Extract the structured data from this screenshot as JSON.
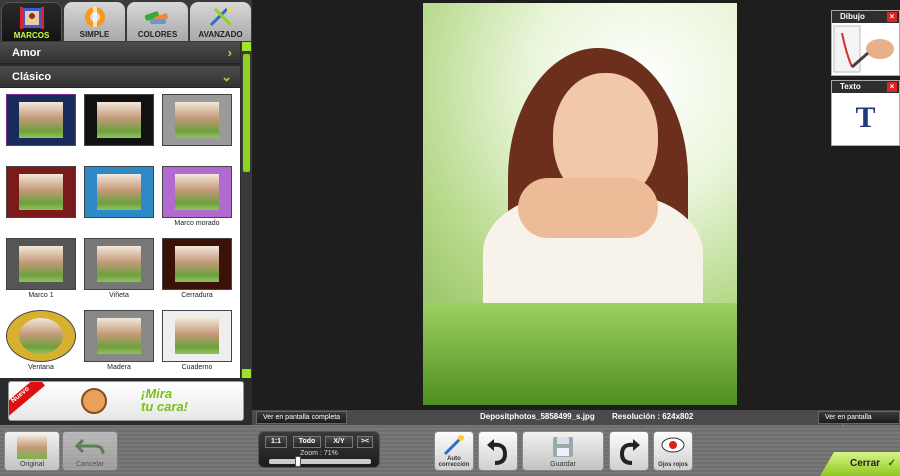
{
  "tabs": [
    {
      "label": "MARCOS",
      "icon": "frames-icon",
      "active": true
    },
    {
      "label": "SIMPLE",
      "icon": "lifebuoy-icon",
      "active": false
    },
    {
      "label": "COLORES",
      "icon": "color-tubes-icon",
      "active": false
    },
    {
      "label": "AVANZADO",
      "icon": "magic-tools-icon",
      "active": false
    }
  ],
  "categories": [
    {
      "label": "Amor",
      "chevron": "›"
    },
    {
      "label": "Clásico",
      "chevron": "⌄"
    }
  ],
  "frames": [
    {
      "caption": ""
    },
    {
      "caption": ""
    },
    {
      "caption": ""
    },
    {
      "caption": ""
    },
    {
      "caption": ""
    },
    {
      "caption": "Marco morado"
    },
    {
      "caption": "Marco 1"
    },
    {
      "caption": "Viñeta"
    },
    {
      "caption": "Cerradura"
    },
    {
      "caption": "Ventana"
    },
    {
      "caption": "Madera"
    },
    {
      "caption": "Cuaderno"
    }
  ],
  "promo": {
    "badge": "Nuevo",
    "text_line1": "¡Mira",
    "text_line2": "tu cara!"
  },
  "status": {
    "fullscreen_left": "Ver en pantalla completa",
    "fullscreen_right": "Ver en pantalla completa",
    "filename": "Depositphotos_5858499_s.jpg",
    "resolution": "Resolución : 624x802"
  },
  "right_panels": [
    {
      "title": "Dibujo",
      "close": "×"
    },
    {
      "title": "Texto",
      "close": "×",
      "glyph": "T"
    }
  ],
  "toolbar": {
    "original": "Original",
    "cancel": "Cancelar",
    "zoom_buttons": [
      "1:1",
      "Todo",
      "X/Y",
      "><"
    ],
    "zoom_label": "Zoom : 71%",
    "zoom_value": 0.71,
    "auto": "Auto corrección",
    "save": "Guardar",
    "redeyes": "Ojos rojos",
    "close": "Cerrar"
  },
  "colors": {
    "accent": "#9ce32a",
    "panel": "#2b2b2b",
    "close_red": "#dd2222"
  }
}
